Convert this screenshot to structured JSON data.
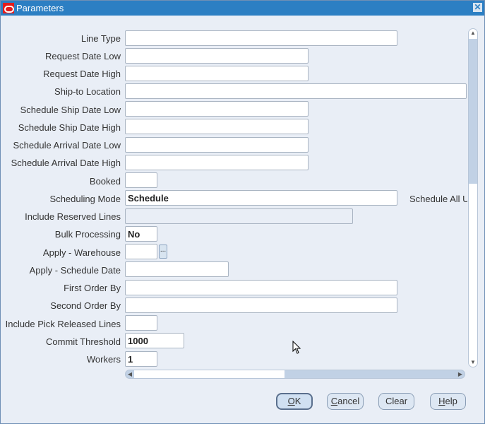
{
  "window": {
    "title": "Parameters",
    "close_label": "✕"
  },
  "fields": [
    {
      "label": "Line Type",
      "value": ""
    },
    {
      "label": "Request Date Low",
      "value": ""
    },
    {
      "label": "Request Date High",
      "value": ""
    },
    {
      "label": "Ship-to Location",
      "value": ""
    },
    {
      "label": "Schedule Ship Date Low",
      "value": ""
    },
    {
      "label": "Schedule Ship Date High",
      "value": ""
    },
    {
      "label": "Schedule Arrival Date Low",
      "value": ""
    },
    {
      "label": "Schedule Arrival Date High",
      "value": ""
    },
    {
      "label": "Booked",
      "value": ""
    },
    {
      "label": "Scheduling Mode",
      "value": "Schedule",
      "description": "Schedule All U"
    },
    {
      "label": "Include Reserved Lines",
      "value": ""
    },
    {
      "label": "Bulk Processing",
      "value": "No"
    },
    {
      "label": "Apply - Warehouse",
      "value": "",
      "lov_label": "..."
    },
    {
      "label": "Apply - Schedule Date",
      "value": ""
    },
    {
      "label": "First Order By",
      "value": ""
    },
    {
      "label": "Second Order By",
      "value": ""
    },
    {
      "label": "Include Pick Released Lines",
      "value": ""
    },
    {
      "label": "Commit Threshold",
      "value": "1000"
    },
    {
      "label": "Workers",
      "value": "1"
    }
  ],
  "scroll": {
    "up": "▲",
    "down": "▼",
    "left": "◀",
    "right": "▶"
  },
  "buttons": {
    "ok": {
      "mnemonic": "O",
      "rest": "K"
    },
    "cancel": {
      "mnemonic": "C",
      "rest": "ancel"
    },
    "clear": {
      "label": "Clear"
    },
    "help": {
      "mnemonic": "H",
      "rest": "elp"
    }
  }
}
